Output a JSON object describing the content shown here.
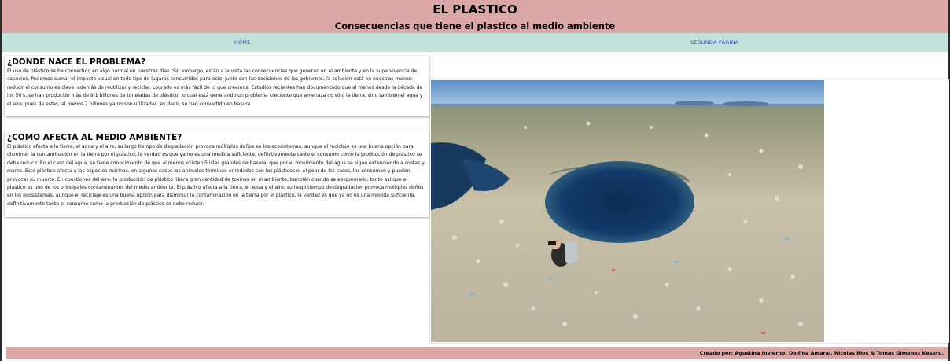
{
  "header": {
    "title": "EL PLASTICO",
    "subtitle": "Consecuencias que tiene el plastico al medio ambiente"
  },
  "nav": {
    "home_label": "HOME",
    "second_label": "SEGUNDA PAGINA"
  },
  "sections": [
    {
      "heading": "¿DONDE NACE EL PROBLEMA?",
      "body": "El uso de plástico se ha convertido en algo normal en nuestras días. Sin embargo, están a la vista las consecuencias que generan en el ambiente y en la supervivencia de especies. Podemos sumar el impacto visual en todo tipo de lugares concurridos para ocio. Junto con las decisiones de los gobiernos, la solución está en nuestras manos: reducir el consumo es clave, además de reutilizar y reciclar. Lograrlo es más fácil de lo que creemos. Estudios recientes han documentado que al menos desde la década de los 50's, se han producido más de 9,1 billones de toneladas de plástico, lo cual está generando un problema creciente que amenaza no sólo la tierra, sino también el agua y el aire; pues de estas, al menos 7 billones ya no son utilizadas, es decir, se han convertido en basura."
    },
    {
      "heading": "¿COMO AFECTA AL MEDIO AMBIENTE?",
      "body": "El plástico afecta a la tierra, el agua y el aire, su largo tiempo de degradación provoca múltiples daños en los ecosistemas, aunque el reciclaje es una buena opción para disminuir la contaminación en la tierra por el plástico, la verdad es que ya no es una medida suficiente, definitivamente tanto el consumo como la producción de plástico se debe reducir. En el caso del agua, se tiene conocimiento de que al menos existen 5 islas grandes de basura, que por el movimiento del agua se sigue extendiendo a costas y mares. Este plástico afecta a las especies marinas, en algunos casos los animales terminan enredados con los plásticos o, el peor de los casos, los consumen y pueden provocar su muerte. En cuestiones del aire, la producción de plástico libera gran cantidad de toxinas en el ambiente, también cuando se es quemado, tanto así que el plástico es uno de los principales contaminantes del medio ambiente. El plástico afecta a la tierra, el agua y el aire, su largo tiempo de degradación provoca múltiples daños en los ecosistemas, aunque el reciclaje es una buena opción para disminuir la contaminación en la tierra por el plástico, la verdad es que ya no es una medida suficiente, definitivamente tanto el consumo como la producción de plástico se debe reducir."
    }
  ],
  "footer": {
    "credit": "Creado por: Agustina Invierno, Delfina Amaral, Nicolas Rios & Tomas Gimenez Keseru."
  },
  "colors": {
    "header_bg": "#dca7a7",
    "nav_bg": "#c1e3dc",
    "nav_link": "#3a3acb"
  },
  "image": {
    "subject": "ocean-plastic-photo"
  }
}
